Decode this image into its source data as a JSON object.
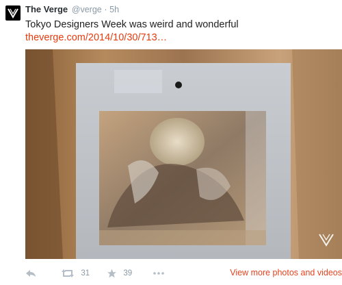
{
  "tweet": {
    "author_name": "The Verge",
    "handle": "@verge",
    "separator": "·",
    "time": "5h",
    "text": "Tokyo Designers Week was weird and wonderful",
    "link": "theverge.com/2014/10/30/713…",
    "avatar_icon": "verge-logo-icon",
    "media_watermark": "verge-logo-icon"
  },
  "actions": {
    "reply_icon": "reply-icon",
    "retweet_icon": "retweet-icon",
    "retweet_count": "31",
    "favorite_icon": "star-icon",
    "favorite_count": "39",
    "more_icon": "more-icon",
    "view_more": "View more photos and videos"
  },
  "colors": {
    "link": "#e63b0e",
    "name": "#292f33",
    "muted": "#8899a6",
    "icon": "#b5bec6"
  }
}
